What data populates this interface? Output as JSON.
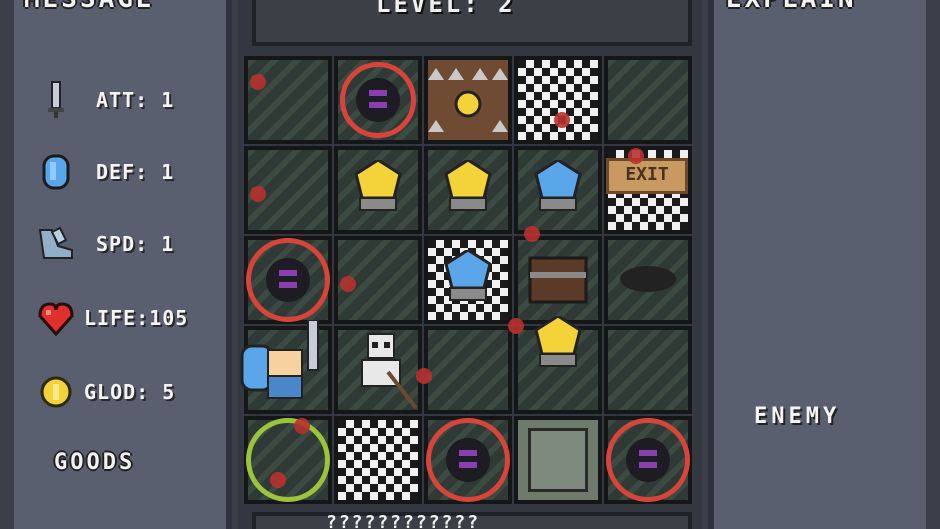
{
  "left_panel": {
    "title": "MESSAGE",
    "stats": [
      {
        "label": "ATT: 1",
        "icon": "sword-icon"
      },
      {
        "label": "DEF: 1",
        "icon": "shield-icon"
      },
      {
        "label": "SPD: 1",
        "icon": "boot-icon"
      },
      {
        "label": "LIFE:105",
        "icon": "heart-icon"
      },
      {
        "label": "GLOD: 5",
        "icon": "coin-icon"
      }
    ],
    "goods_label": "GOODS"
  },
  "board": {
    "level_text": "LEVEL: 2",
    "bottom_text": "????????????",
    "exit_label": "EXIT"
  },
  "right_panel": {
    "title": "EXPLAIN",
    "enemy_label": "ENEMY"
  },
  "colors": {
    "panel": "#5a5f6f",
    "red_ring": "#d8443a",
    "green_ring": "#9cc43a",
    "gold": "#f4d23a",
    "blue_gem": "#5aa6e8"
  }
}
